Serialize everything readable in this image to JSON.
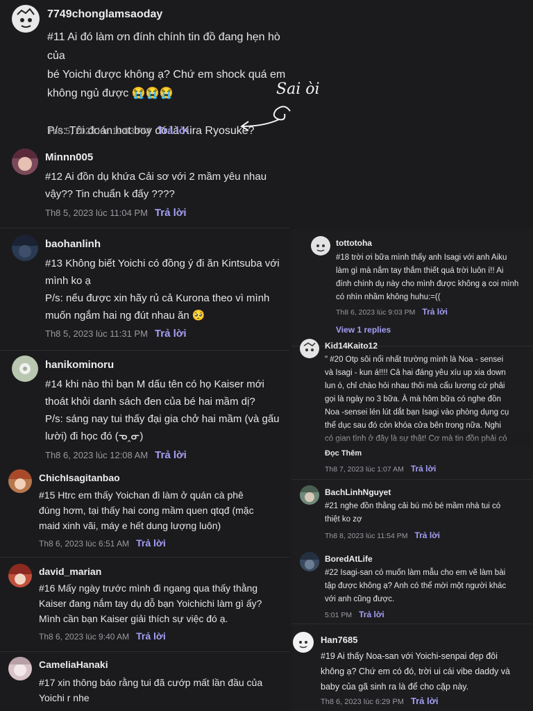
{
  "annotation": {
    "text": "Sai òi"
  },
  "left": [
    {
      "user": "7749chonglamsaoday",
      "text": "#11 Ai đó làm ơn đính chính tin đồ đang hẹn hò của\nbé Yoichi được không ạ? Chứ em shock quá em\nkhông ngủ được 😭😭😭\n\nP/s: Tôi đoán hot boy đó là Kira Ryosuke?",
      "time": "Th8 5, 2023 lúc 10:03 PM",
      "reply": "Trả lời",
      "avatar_color": "#e8e8e8"
    },
    {
      "user": "Minnn005",
      "text": "#12 Ai đồn dụ khứa Cải sơ với 2 mầm yêu nhau\nvậy?? Tin chuẩn k đấy ????",
      "time": "Th8 5, 2023 lúc 11:04 PM",
      "reply": "Trả lời",
      "avatar_color": "#7a4a5a"
    },
    {
      "user": "baohanlinh",
      "text": "#13 Không biết Yoichi có đồng ý đi ăn Kintsuba với\nmình ko ạ\nP/s: nếu được xin hãy rủ cả Kurona theo vì mình\nmuốn ngắm hai ng đút nhau ăn 🥺",
      "time": "Th8 5, 2023 lúc 11:31 PM",
      "reply": "Trả lời",
      "avatar_color": "#2a3a52"
    },
    {
      "user": "hanikominoru",
      "text": "#14 khi nào thì bạn M dấu tên có họ Kaiser mới\nthoát khỏi danh sách đen của bé hai mầm dị?\nP/s: sáng nay tui thấy đại gia chở hai mầm (và gấu\nlười) đi học đó (ᓀ‸ᓂ)",
      "time": "Th8 6, 2023 lúc 12:08 AM",
      "reply": "Trả lời",
      "avatar_color": "#b9c7b0"
    },
    {
      "user": "ChichIsagitanbao",
      "text": "#15 Htrc em thấy Yoichan đi làm ở quán cà phê\nđúng hơm, tại thấy hai cong mầm quen qtqđ (mặc\nmaid xinh vãi, máy e hết dung lượng luôn)",
      "time": "Th8 6, 2023 lúc 6:51 AM",
      "reply": "Trả lời",
      "avatar_color": "#b8784e"
    },
    {
      "user": "david_marian",
      "text": "#16 Mấy ngày trước mình đi ngang qua thấy thằng\nKaiser đang nắm tay dụ dỗ bạn Yoichichi làm gì ấy?\nMình cần bạn Kaiser giải thích sự việc đó ạ.",
      "time": "Th8 6, 2023 lúc 9:40 AM",
      "reply": "Trả lời",
      "avatar_color": "#c0503c"
    },
    {
      "user": "CameliaHanaki",
      "text": "#17 xin thông báo rằng tui đã cướp mất lần đầu của\nYoichi r nhe",
      "time": "",
      "reply": "",
      "avatar_color": "#d8c4c8"
    }
  ],
  "right": [
    {
      "user": "tottotoha",
      "text": "#18 trời ơi bữa mình thấy anh Isagi với anh Aiku\nlàm gì mà nắm tay thắm thiết quá trời luôn í!! Ai\nđính chính dụ này cho mình được không ạ coi mình\ncó nhìn nhầm không huhu:=((",
      "time": "Th8 6, 2023 lúc 9:03 PM",
      "reply": "Trả lời",
      "avatar_color": "#e2e2e2",
      "view_replies": "View 1 replies"
    },
    {
      "user": "Kid14Kaito12",
      "text": "\" #20 Otp sôi nổi nhất trường mình là Noa - sensei\nvà Isagi - kun á!!!! Cả hai đáng yêu xíu up xia down\nlun ó, chỉ chào hỏi nhau thôi mà cẩu lương cứ phải\ngọi là ngày no 3 bữa. À mà hôm bữa có nghe đồn\nNoa -sensei lén lút dắt bạn Isagi vào phòng dụng cụ\nthể dục sau đó còn khóa cửa bên trong nữa. Nghi\ncó gian tình ở đây là sự thật! Cơ mà tin đồn phải có",
      "time": "Th8 7, 2023 lúc 1:07 AM",
      "reply": "Trả lời",
      "avatar_color": "#e4e4e4",
      "read_more": "Đọc Thêm"
    },
    {
      "user": "BachLinhNguyet",
      "text": "#21 nghe đồn thằng cải bú mỏ bé mầm nhà tui có\nthiệt ko zợ",
      "time": "Th8 8, 2023 lúc 11:54 PM",
      "reply": "Trả lời",
      "avatar_color": "#6f8a7a"
    },
    {
      "user": "BoredAtLife",
      "text": "#22 Isagi-san có muốn làm mẫu cho em vẽ làm bài\ntập được không ạ? Anh có thể mời một người khác\nvới anh cũng được.",
      "time": "5:01 PM",
      "reply": "Trả lời",
      "avatar_color": "#3a4a5e"
    },
    {
      "user": "Han7685",
      "text": "#19 Ai thấy Noa-san với Yoichi-senpai đẹp đôi\nkhông ạ? Chứ em có đó, trời ui cái vibe daddy và\nbaby của gã sinh ra là để cho cặp này.",
      "time": "Th8 6, 2023 lúc 6:29 PM",
      "reply": "Trả lời",
      "avatar_color": "#f2f2f2"
    }
  ]
}
